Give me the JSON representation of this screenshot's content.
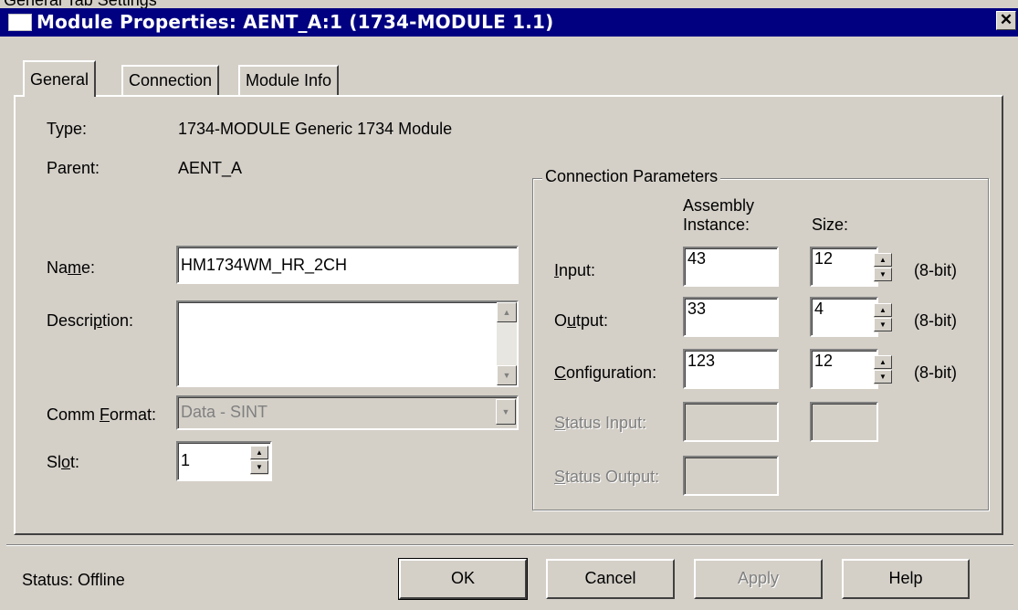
{
  "caption": "General Tab Settings",
  "window": {
    "title": "Module Properties: AENT_A:1 (1734-MODULE 1.1)",
    "close_glyph": "✕"
  },
  "tabs": [
    {
      "label": "General",
      "active": true
    },
    {
      "label": "Connection",
      "active": false
    },
    {
      "label": "Module Info",
      "active": false
    }
  ],
  "general": {
    "type_label": "Type:",
    "type_value": "1734-MODULE Generic 1734 Module",
    "parent_label": "Parent:",
    "parent_value": "AENT_A",
    "name_label": "Name:",
    "name_value": "HM1734WM_HR_2CH",
    "description_label": "Description:",
    "description_value": "",
    "comm_format_label": "Comm Format:",
    "comm_format_value": "Data - SINT",
    "slot_label": "Slot:",
    "slot_value": "1"
  },
  "connection_parameters": {
    "title": "Connection Parameters",
    "assembly_header": "Assembly\nInstance:",
    "size_header": "Size:",
    "rows": [
      {
        "label": "Input:",
        "instance": "43",
        "size": "12",
        "unit": "(8-bit)"
      },
      {
        "label": "Output:",
        "instance": "33",
        "size": "4",
        "unit": "(8-bit)"
      },
      {
        "label": "Configuration:",
        "instance": "123",
        "size": "12",
        "unit": "(8-bit)"
      },
      {
        "label": "Status Input:",
        "instance": "",
        "size": ""
      },
      {
        "label": "Status Output:",
        "instance": ""
      }
    ]
  },
  "status": {
    "text": "Status:  Offline"
  },
  "buttons": {
    "ok": "OK",
    "cancel": "Cancel",
    "apply": "Apply",
    "help": "Help"
  },
  "colors": {
    "titlebar": "#000080",
    "dialog": "#d4d0c8"
  }
}
